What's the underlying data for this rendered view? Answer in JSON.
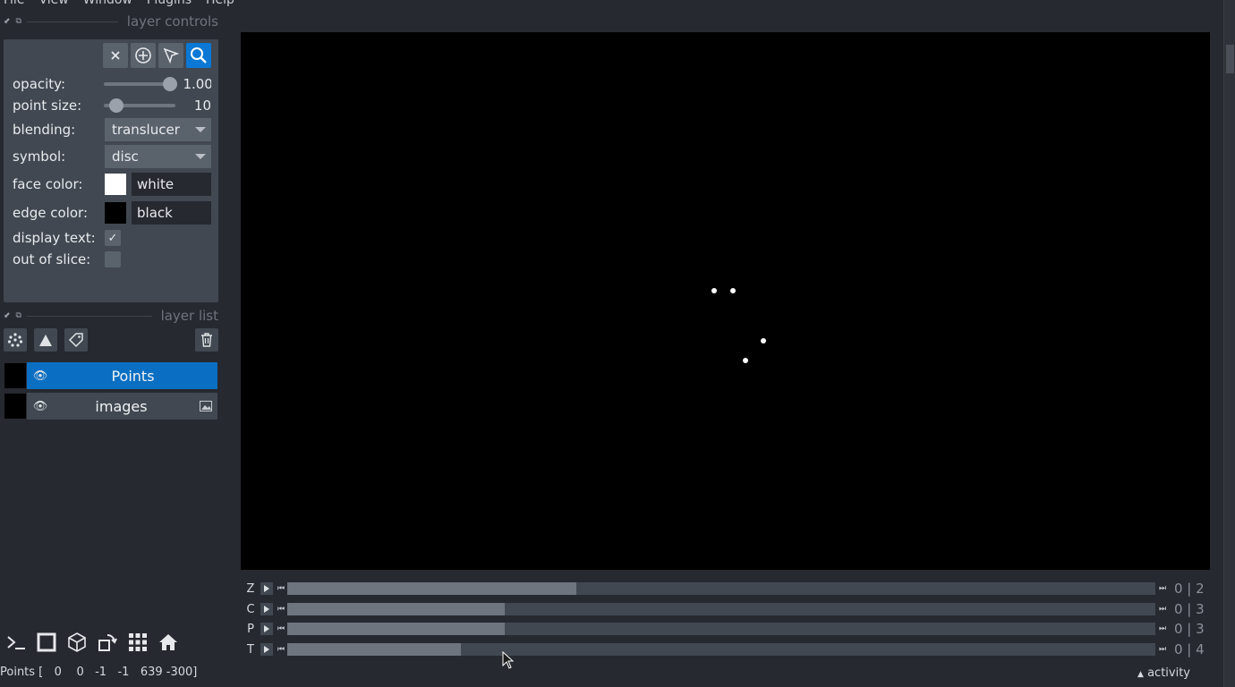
{
  "menu": [
    "File",
    "View",
    "Window",
    "Plugins",
    "Help"
  ],
  "layer_controls": {
    "title": "layer controls",
    "opacity": {
      "label": "opacity:",
      "value": "1.00",
      "fraction": 1.0
    },
    "point_size": {
      "label": "point size:",
      "value": "10",
      "fraction": 0.1
    },
    "blending": {
      "label": "blending:",
      "value": "translucer"
    },
    "symbol": {
      "label": "symbol:",
      "value": "disc"
    },
    "face_color": {
      "label": "face color:",
      "value": "white",
      "swatch": "#ffffff"
    },
    "edge_color": {
      "label": "edge color:",
      "value": "black",
      "swatch": "#000000"
    },
    "display_text": {
      "label": "display text:",
      "checked": true
    },
    "out_of_slice": {
      "label": "out of slice:",
      "checked": false
    }
  },
  "layer_list": {
    "title": "layer list",
    "layers": [
      {
        "name": "Points",
        "selected": true
      },
      {
        "name": "images",
        "selected": false
      }
    ]
  },
  "dims": [
    {
      "label": "Z",
      "value": "0 | 2",
      "fraction": 0.333
    },
    {
      "label": "C",
      "value": "0 | 3",
      "fraction": 0.25
    },
    {
      "label": "P",
      "value": "0 | 3",
      "fraction": 0.25
    },
    {
      "label": "T",
      "value": "0 | 4",
      "fraction": 0.2
    }
  ],
  "status": "Points [   0    0   -1   -1   639 -300]",
  "activity": "activity",
  "colors": {
    "accent": "#0a78d4",
    "panel": "#414851",
    "background": "#262930",
    "canvas": "#000000"
  }
}
